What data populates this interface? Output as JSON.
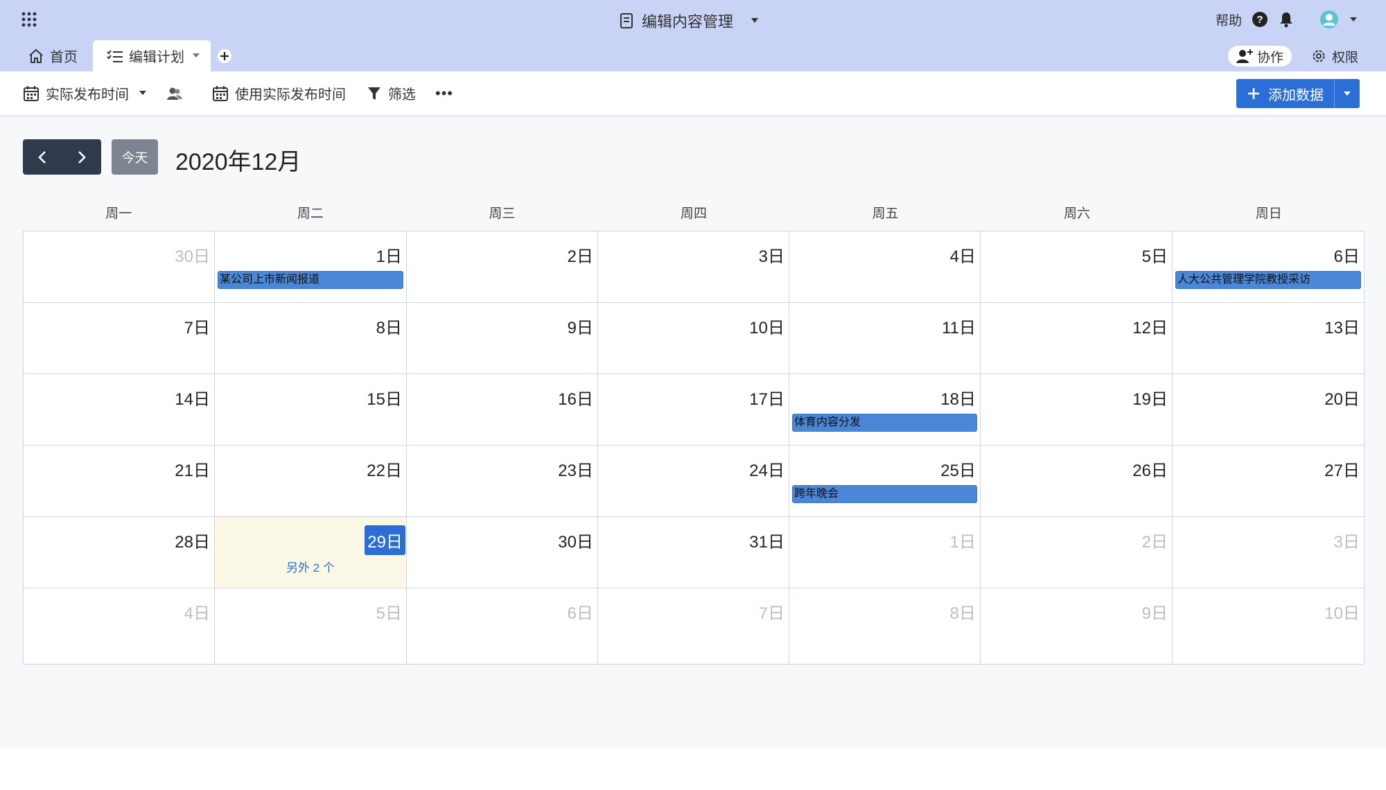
{
  "header": {
    "title": "编辑内容管理",
    "help_label": "帮助"
  },
  "tabs": {
    "home_label": "首页",
    "active_label": "编辑计划"
  },
  "actions": {
    "collab_label": "协作",
    "perm_label": "权限"
  },
  "toolbar": {
    "date_field_label": "实际发布时间",
    "use_date_label": "使用实际发布时间",
    "filter_label": "筛选",
    "more_label": "•••",
    "add_label": "添加数据"
  },
  "calendar": {
    "today_label": "今天",
    "month_title": "2020年12月",
    "weekdays": [
      "周一",
      "周二",
      "周三",
      "周四",
      "周五",
      "周六",
      "周日"
    ],
    "more_events_label": "另外 2 个",
    "days": [
      "30日",
      "1日",
      "2日",
      "3日",
      "4日",
      "5日",
      "6日",
      "7日",
      "8日",
      "9日",
      "10日",
      "11日",
      "12日",
      "13日",
      "14日",
      "15日",
      "16日",
      "17日",
      "18日",
      "19日",
      "20日",
      "21日",
      "22日",
      "23日",
      "24日",
      "25日",
      "26日",
      "27日",
      "28日",
      "29日",
      "30日",
      "31日",
      "1日",
      "2日",
      "3日",
      "4日",
      "5日",
      "6日",
      "7日",
      "8日",
      "9日",
      "10日"
    ],
    "events": [
      "某公司上市新闻报道",
      "人大公共管理学院教授采访",
      "体育内容分发",
      "跨年晚会"
    ]
  },
  "colors": {
    "topbar_bg": "#c8d3f6",
    "primary": "#2b6fd6",
    "event_bg": "#4a87d6",
    "today_cell_bg": "#fbf8e6",
    "nav_bg": "#2f3b4d"
  }
}
